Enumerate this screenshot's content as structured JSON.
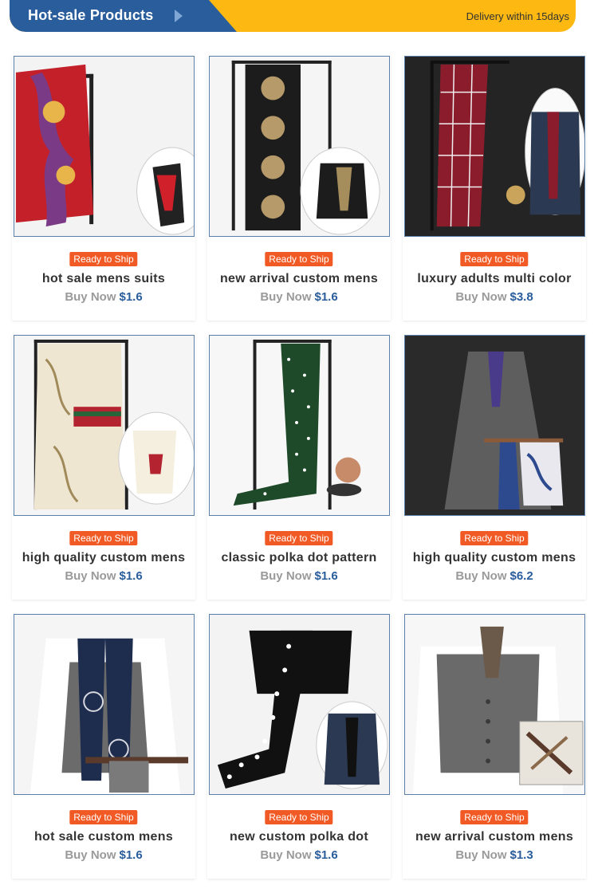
{
  "header": {
    "title": "Hot-sale Products",
    "delivery": "Delivery within 15days",
    "colors": {
      "primary": "#2a5d9c",
      "accent": "#fdb912"
    }
  },
  "badge_color": "#f15a24",
  "products": [
    {
      "badge": "Ready to Ship",
      "title": "hot sale mens suits",
      "buy_label": "Buy Now",
      "price": "$1.6",
      "image": "paisley red scarf on rack"
    },
    {
      "badge": "Ready to Ship",
      "title": "new arrival custom mens",
      "buy_label": "Buy Now",
      "price": "$1.6",
      "image": "black ornate print scarf on rack"
    },
    {
      "badge": "Ready to Ship",
      "title": "luxury adults multi color",
      "buy_label": "Buy Now",
      "price": "$3.8",
      "image": "burgundy plaid scarf on rack"
    },
    {
      "badge": "Ready to Ship",
      "title": "high quality custom mens",
      "buy_label": "Buy Now",
      "price": "$1.6",
      "image": "cream equestrian print scarf"
    },
    {
      "badge": "Ready to Ship",
      "title": "classic polka dot pattern",
      "buy_label": "Buy Now",
      "price": "$1.6",
      "image": "green polka dot scarf on rack"
    },
    {
      "badge": "Ready to Ship",
      "title": "high quality custom mens",
      "buy_label": "Buy Now",
      "price": "$6.2",
      "image": "grey suit with paisley scarves"
    },
    {
      "badge": "Ready to Ship",
      "title": "hot sale custom mens",
      "buy_label": "Buy Now",
      "price": "$1.6",
      "image": "navy printed scarf on vest"
    },
    {
      "badge": "Ready to Ship",
      "title": "new custom polka dot",
      "buy_label": "Buy Now",
      "price": "$1.6",
      "image": "black polka dot scarf on shirt"
    },
    {
      "badge": "Ready to Ship",
      "title": "new arrival custom mens",
      "buy_label": "Buy Now",
      "price": "$1.3",
      "image": "grey vest with silk scarf"
    }
  ]
}
